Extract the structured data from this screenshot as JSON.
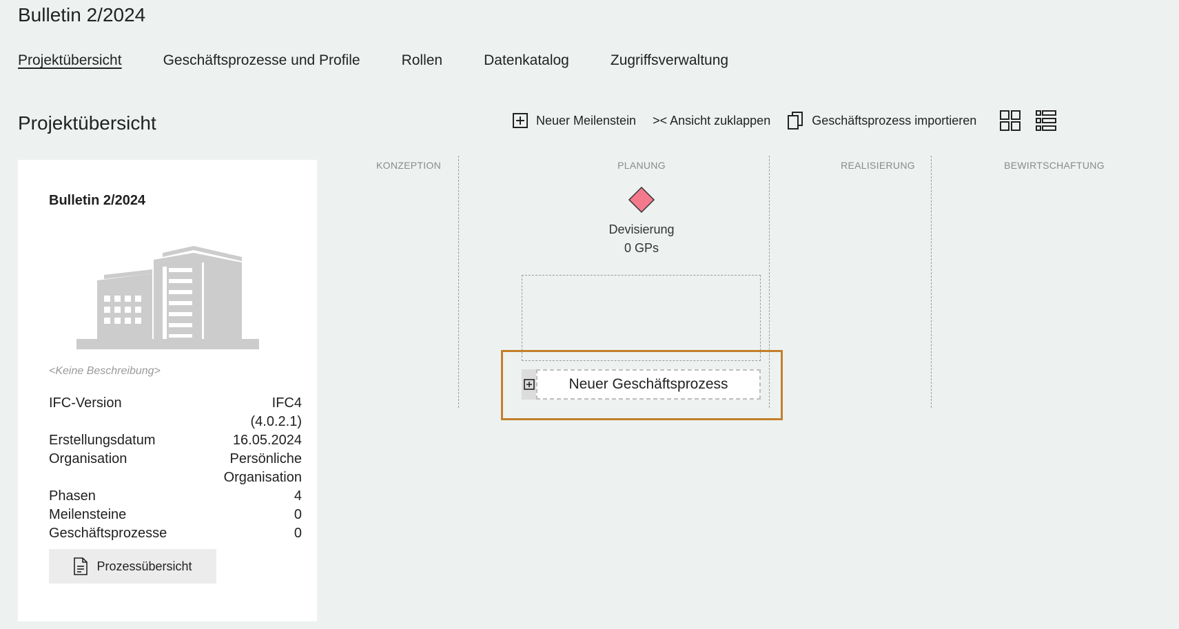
{
  "app_title": "Bulletin 2/2024",
  "nav": [
    {
      "label": "Projektübersicht",
      "active": true
    },
    {
      "label": "Geschäftsprozesse und Profile",
      "active": false
    },
    {
      "label": "Rollen",
      "active": false
    },
    {
      "label": "Datenkatalog",
      "active": false
    },
    {
      "label": "Zugriffsverwaltung",
      "active": false
    }
  ],
  "section_title": "Projektübersicht",
  "toolbar": {
    "new_milestone": "Neuer Meilenstein",
    "collapse": ">< Ansicht zuklappen",
    "import": "Geschäftsprozess importieren",
    "view_grid_icon": "grid-view-icon",
    "view_list_icon": "list-view-icon"
  },
  "card": {
    "title": "Bulletin 2/2024",
    "description": "<Keine Beschreibung>",
    "props": [
      {
        "label": "IFC-Version",
        "value": "IFC4\n(4.0.2.1)"
      },
      {
        "label": "Erstellungsdatum",
        "value": "16.05.2024"
      },
      {
        "label": "Organisation",
        "value": "Persönliche\nOrganisation"
      },
      {
        "label": "Phasen",
        "value": "4"
      },
      {
        "label": "Meilensteine",
        "value": "0"
      },
      {
        "label": "Geschäftsprozesse",
        "value": "0"
      }
    ],
    "button_label": "Prozessübersicht"
  },
  "phases": [
    "KONZEPTION",
    "PLANUNG",
    "REALISIERUNG",
    "BEWIRTSCHAFTUNG"
  ],
  "milestone": {
    "name": "Devisierung",
    "count": "0 GPs",
    "color": "#f27a8c"
  },
  "new_process_label": "Neuer Geschäftsprozess",
  "colors": {
    "background": "#edf2f1",
    "highlight": "#c47f2a"
  }
}
